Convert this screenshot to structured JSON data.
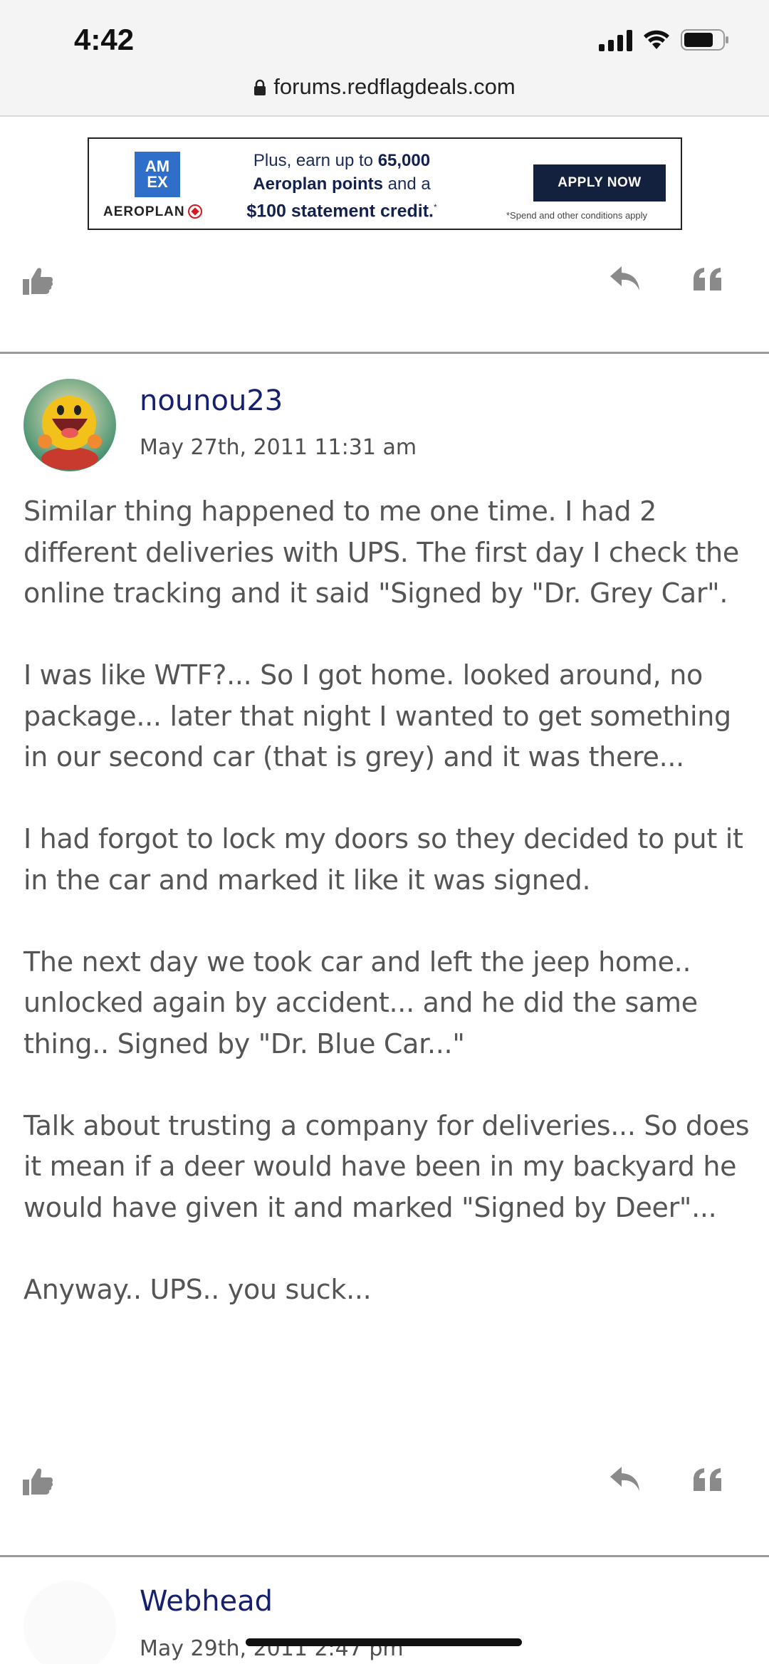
{
  "status_bar": {
    "time": "4:42"
  },
  "browser": {
    "url": "forums.redflagdeals.com"
  },
  "ad": {
    "logo_top": "AM",
    "logo_bottom": "EX",
    "partner": "AEROPLAN",
    "line1_pre": "Plus, earn up to ",
    "line1_bold": "65,000",
    "line2_bold": "Aeroplan points",
    "line2_post": " and a",
    "line3_bold": "$100 statement credit.",
    "line3_sup": "*",
    "cta": "APPLY NOW",
    "fine_print": "*Spend and other conditions apply"
  },
  "posts": [
    {
      "username": "nounou23",
      "date": "May 27th, 2011 11:31 am",
      "paragraphs": [
        "Similar thing happened to me one time. I had 2 different deliveries with UPS. The first day I check the online tracking and it said \"Signed by \"Dr. Grey Car\".",
        "I was like WTF?... So I got home. looked around, no package... later that night I wanted to get something in our second car (that is grey) and it was there...",
        "I had forgot to lock my doors so they decided to put it in the car and marked it like it was signed.",
        "The next day we took car and left the jeep home.. unlocked again by accident... and he did the same thing.. Signed by \"Dr. Blue Car...\"",
        "Talk about trusting a company for deliveries... So does it mean if a deer would have been in my backyard he would have given it and marked \"Signed by Deer\"...",
        "Anyway.. UPS.. you suck..."
      ]
    },
    {
      "username": "Webhead",
      "date": "May 29th, 2011 2:47 pm"
    }
  ],
  "icons": {
    "like": "thumbs-up-icon",
    "reply": "reply-arrow-icon",
    "quote": "quote-icon"
  },
  "colors": {
    "username": "#15206e",
    "cta_bg": "#13213f",
    "amex_blue": "#2f6fca"
  }
}
